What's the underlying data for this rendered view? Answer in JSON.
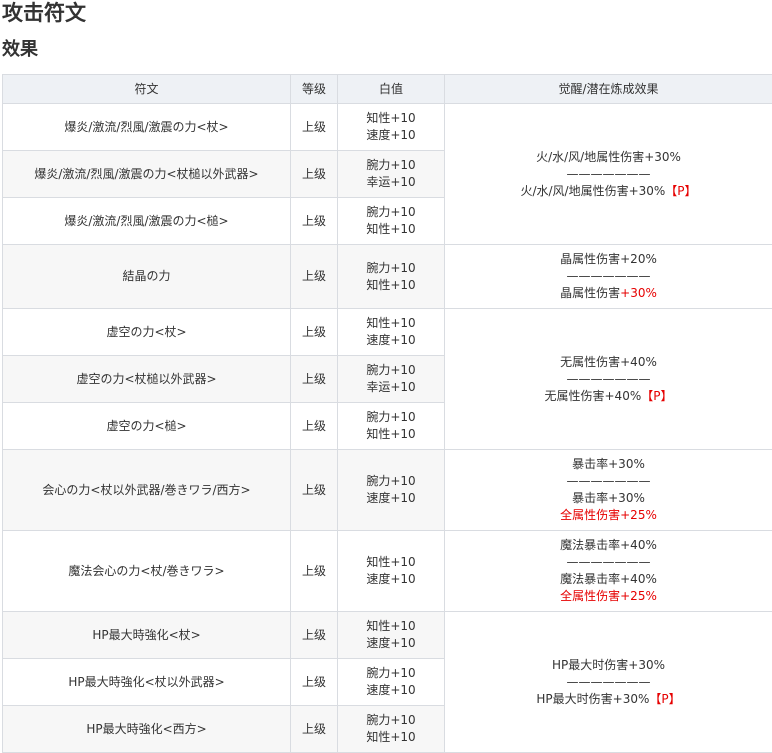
{
  "title": "攻击符文",
  "subtitle": "效果",
  "colors": {
    "header_bg": "#eef1f5",
    "alt_row_bg": "#f7f7f7",
    "border": "#d9dce1",
    "highlight": "#e60000"
  },
  "table": {
    "headers": [
      "符文",
      "等级",
      "白值",
      "觉醒/潜在炼成效果"
    ],
    "rows": [
      {
        "name": "爆炎/激流/烈風/激震の力<杖>",
        "level": "上级",
        "stats": [
          "知性+10",
          "速度+10"
        ]
      },
      {
        "name": "爆炎/激流/烈風/激震の力<杖槌以外武器>",
        "level": "上级",
        "stats": [
          "腕力+10",
          "幸运+10"
        ]
      },
      {
        "name": "爆炎/激流/烈風/激震の力<槌>",
        "level": "上级",
        "stats": [
          "腕力+10",
          "知性+10"
        ]
      },
      {
        "name": "結晶の力",
        "level": "上级",
        "stats": [
          "腕力+10",
          "知性+10"
        ]
      },
      {
        "name": "虚空の力<杖>",
        "level": "上级",
        "stats": [
          "知性+10",
          "速度+10"
        ]
      },
      {
        "name": "虚空の力<杖槌以外武器>",
        "level": "上级",
        "stats": [
          "腕力+10",
          "幸运+10"
        ]
      },
      {
        "name": "虚空の力<槌>",
        "level": "上级",
        "stats": [
          "腕力+10",
          "知性+10"
        ]
      },
      {
        "name": "会心の力<杖以外武器/巻きワラ/西方>",
        "level": "上级",
        "stats": [
          "腕力+10",
          "速度+10"
        ]
      },
      {
        "name": "魔法会心の力<杖/巻きワラ>",
        "level": "上级",
        "stats": [
          "知性+10",
          "速度+10"
        ]
      },
      {
        "name": "HP最大時強化<杖>",
        "level": "上级",
        "stats": [
          "知性+10",
          "速度+10"
        ]
      },
      {
        "name": "HP最大時強化<杖以外武器>",
        "level": "上级",
        "stats": [
          "腕力+10",
          "速度+10"
        ]
      },
      {
        "name": "HP最大時強化<西方>",
        "level": "上级",
        "stats": [
          "腕力+10",
          "知性+10"
        ]
      }
    ],
    "effects": [
      {
        "lines": [
          {
            "text": "火/水/风/地属性伤害+30%"
          },
          {
            "text": "———————"
          },
          {
            "text": "火/水/风/地属性伤害+30%",
            "red": "【P】"
          }
        ]
      },
      {
        "lines": [
          {
            "text": "晶属性伤害+20%"
          },
          {
            "text": "———————"
          },
          {
            "text": "晶属性伤害",
            "red": "+30%"
          }
        ]
      },
      {
        "lines": [
          {
            "text": "无属性伤害+40%"
          },
          {
            "text": "———————"
          },
          {
            "text": "无属性伤害+40%",
            "red": "【P】"
          }
        ]
      },
      {
        "lines": [
          {
            "text": "暴击率+30%"
          },
          {
            "text": "———————"
          },
          {
            "text": "暴击率+30%"
          },
          {
            "text": "",
            "red": "全属性伤害+25%"
          }
        ]
      },
      {
        "lines": [
          {
            "text": "魔法暴击率+40%"
          },
          {
            "text": "———————"
          },
          {
            "text": "魔法暴击率+40%"
          },
          {
            "text": "",
            "red": "全属性伤害+25%"
          }
        ]
      },
      {
        "lines": [
          {
            "text": "HP最大时伤害+30%"
          },
          {
            "text": "———————"
          },
          {
            "text": "HP最大时伤害+30%",
            "red": "【P】"
          }
        ]
      }
    ]
  }
}
